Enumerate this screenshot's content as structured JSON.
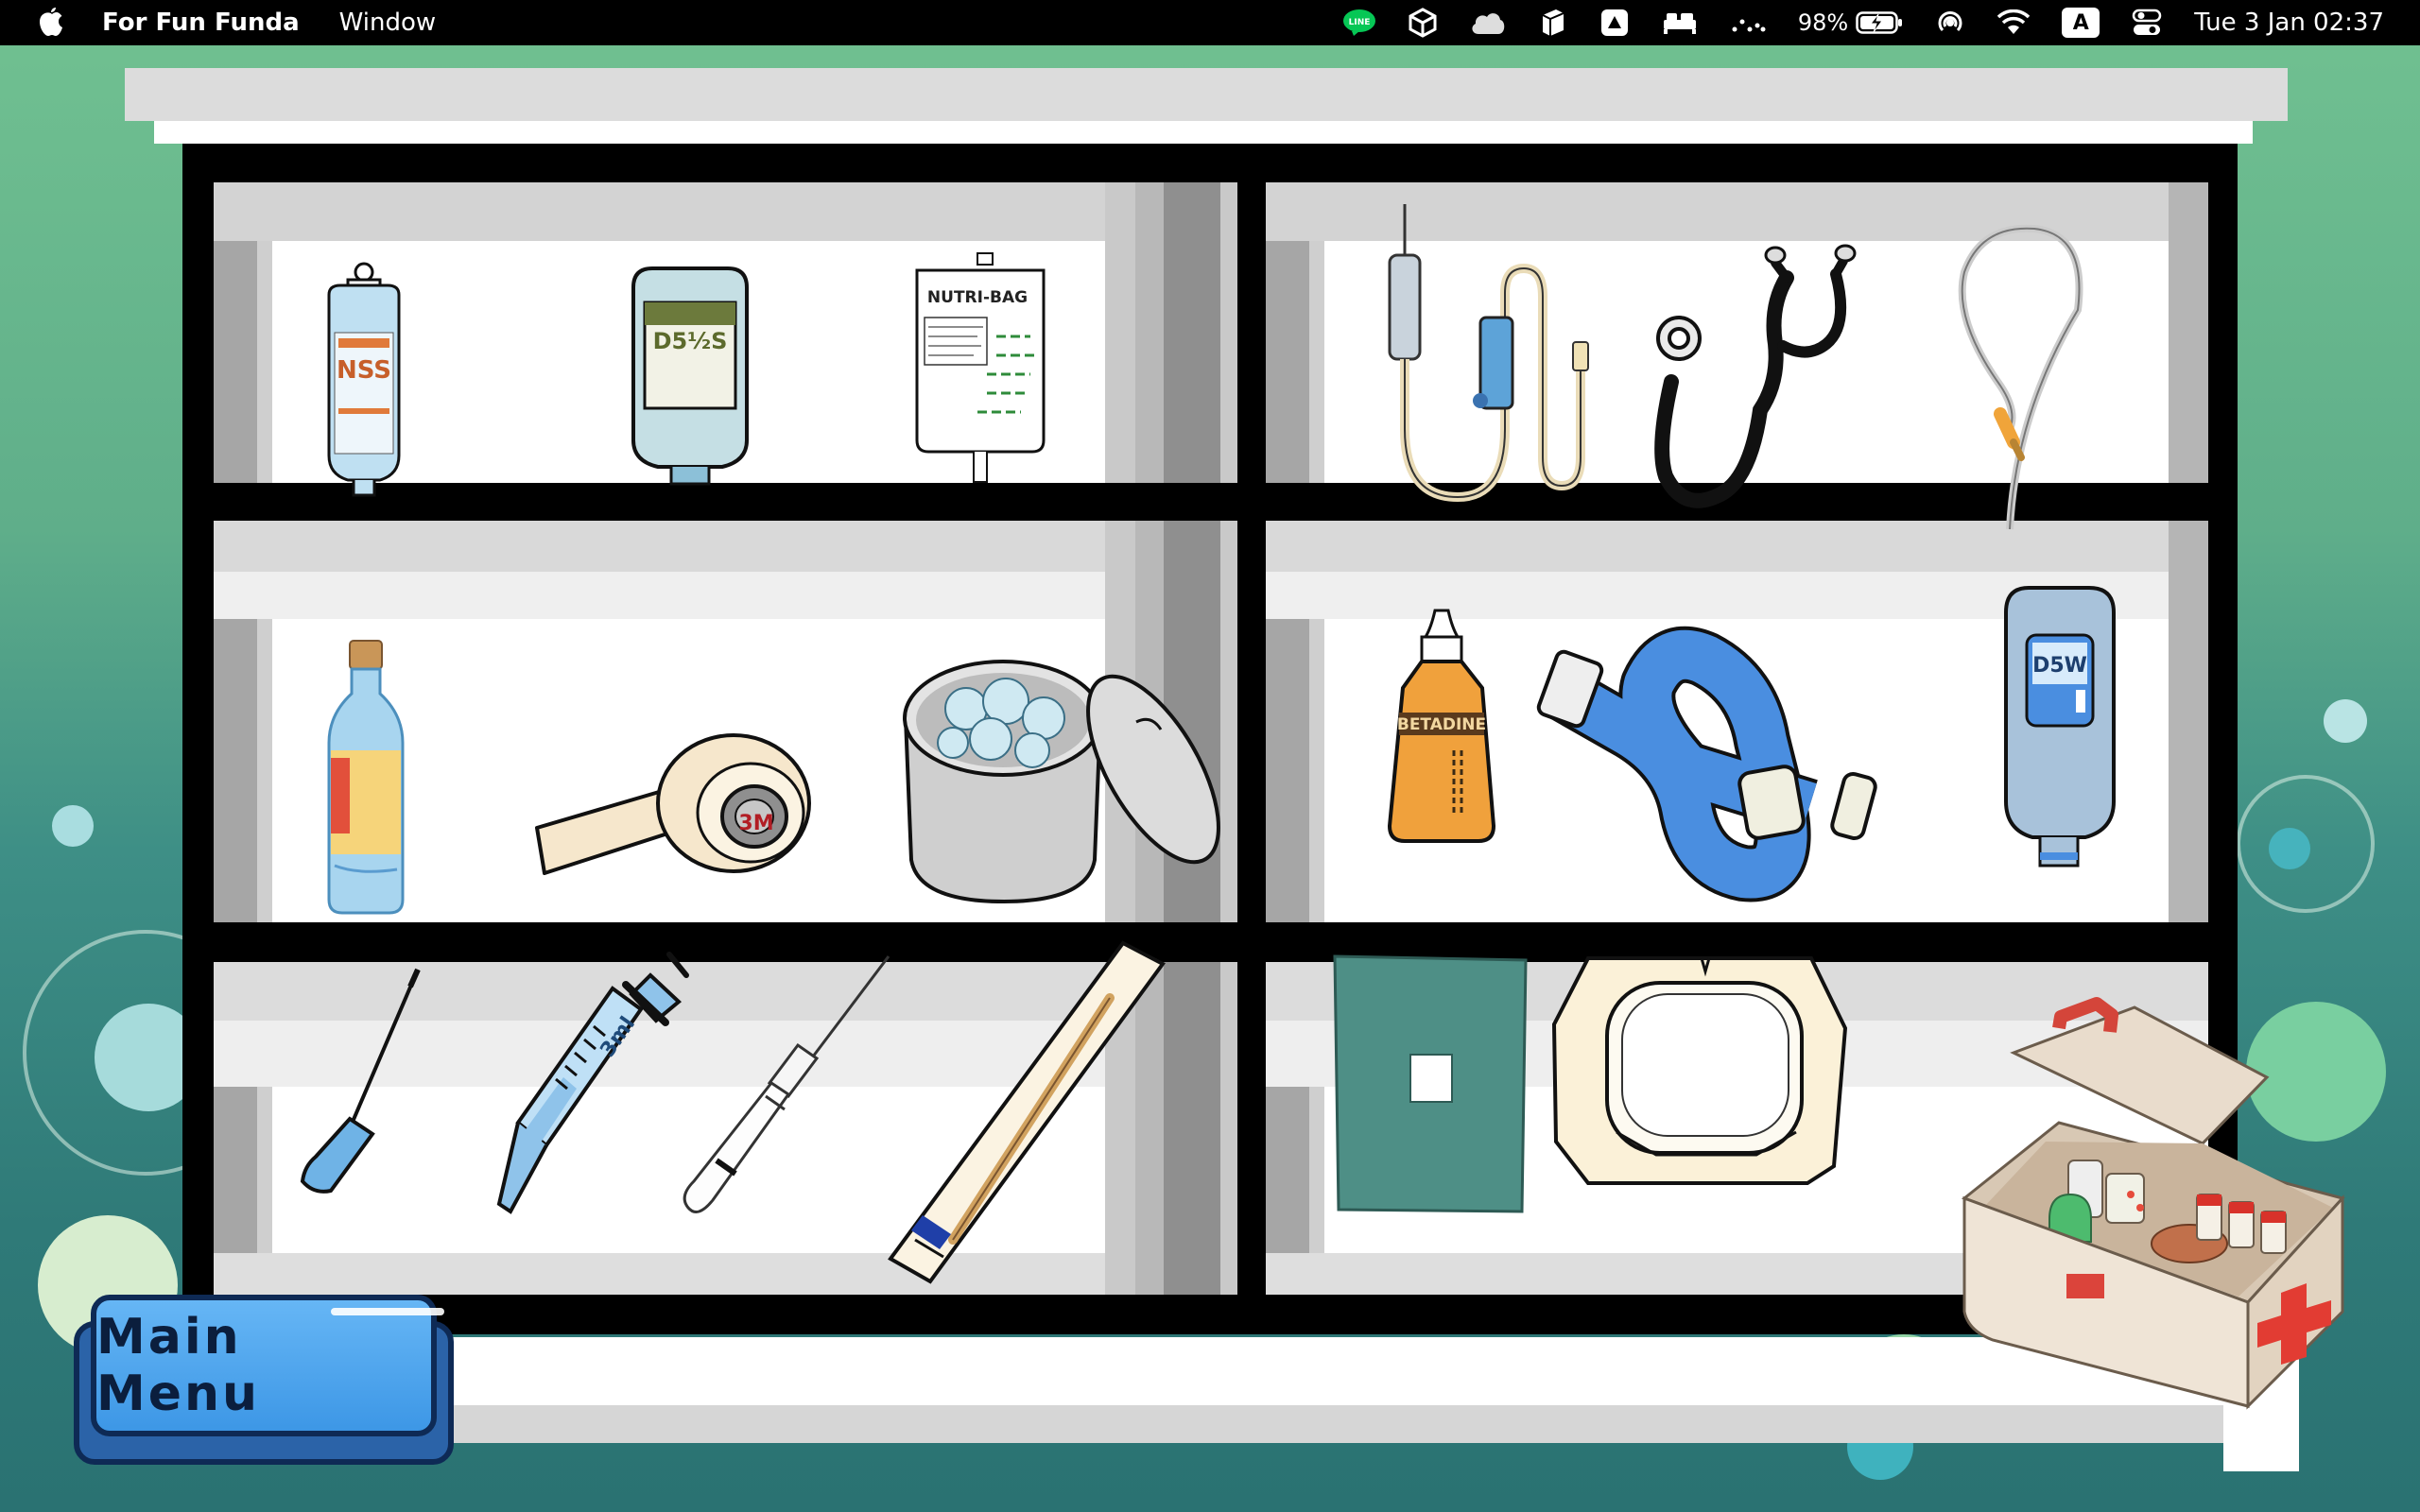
{
  "menubar": {
    "app_name": "For Fun Funda",
    "menus": [
      "Window"
    ],
    "status_icons": [
      "line-icon",
      "unity-icon",
      "cloud-icon",
      "box-icon",
      "drive-icon",
      "bed-icon",
      "dots-icon",
      "battery-icon",
      "airdrop-icon",
      "wifi-icon",
      "keyboard-icon",
      "control-center-icon"
    ],
    "battery_percent": "98%",
    "keyboard_badge": "A",
    "clock": "Tue 3 Jan  02:37"
  },
  "cabinet": {
    "shelves": [
      {
        "side": "left",
        "row": 1,
        "items": [
          "nss-iv-bag-icon",
          "d5-half-s-iv-bag-icon",
          "nutri-bag-icon"
        ]
      },
      {
        "side": "right",
        "row": 1,
        "items": [
          "iv-set-icon",
          "stethoscope-icon",
          "catheter-tube-icon"
        ]
      },
      {
        "side": "left",
        "row": 2,
        "items": [
          "alcohol-bottle-icon",
          "medical-tape-icon",
          "cotton-ball-jar-icon"
        ]
      },
      {
        "side": "right",
        "row": 2,
        "items": [
          "betadine-bottle-icon",
          "tourniquet-icon",
          "d5w-iv-bag-icon"
        ]
      },
      {
        "side": "left",
        "row": 3,
        "items": [
          "needle-icon",
          "syringe-3ml-icon",
          "iv-cannula-icon",
          "sterile-swab-icon"
        ]
      },
      {
        "side": "right",
        "row": 3,
        "items": [
          "sterile-drape-icon",
          "transparent-dressing-icon"
        ]
      }
    ],
    "labels": {
      "nss": "NSS",
      "d5s": "D5½S",
      "nutri": "NUTRI-BAG",
      "betadine": "BETADINE",
      "tape": "3M",
      "d5w": "D5W",
      "syringe": "3ml"
    }
  },
  "first_aid_kit": "first-aid-kit-icon",
  "main_menu_button": {
    "label": "Main Menu"
  },
  "colors": {
    "background_top": "#71c191",
    "background_bottom": "#2a7272",
    "button_blue": "#4aa6ef",
    "button_outline": "#0e2a55"
  }
}
